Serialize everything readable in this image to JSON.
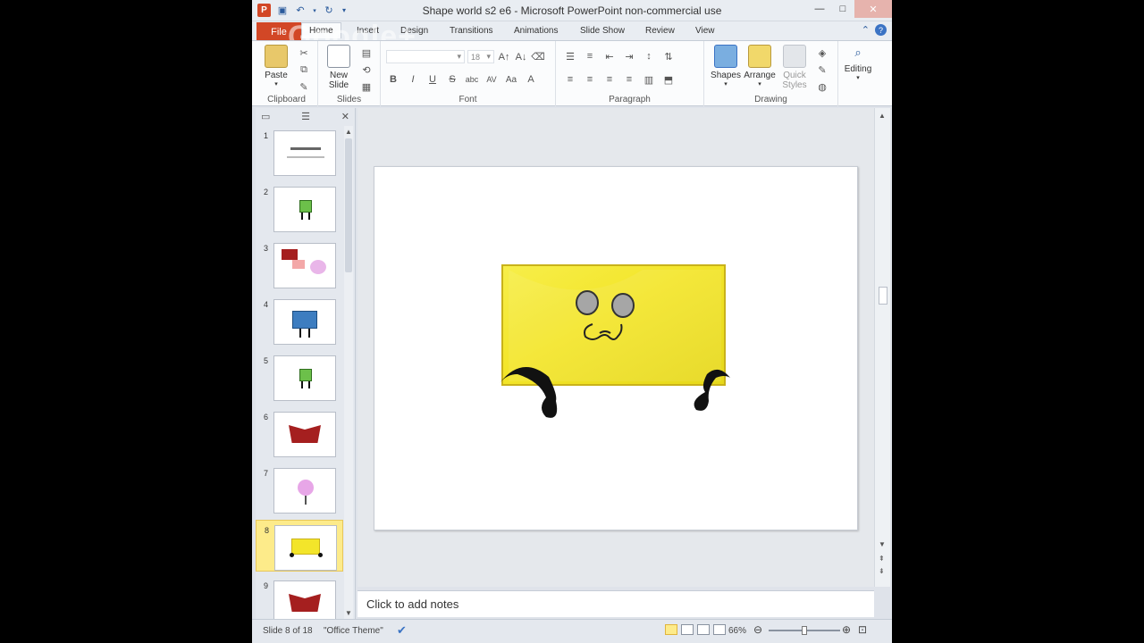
{
  "window": {
    "title": "Shape world s2 e6 - Microsoft PowerPoint non-commercial use",
    "app_letter": "P",
    "minimize": "—",
    "maximize": "□",
    "close": "✕"
  },
  "watermark": "Google+",
  "ribbon": {
    "file_tab": "File",
    "tabs": [
      "Home",
      "Insert",
      "Design",
      "Transitions",
      "Animations",
      "Slide Show",
      "Review",
      "View"
    ],
    "clipboard": {
      "paste": "Paste",
      "label": "Clipboard"
    },
    "slides": {
      "new_slide": "New\nSlide",
      "label": "Slides"
    },
    "font": {
      "font_size": "18",
      "label": "Font",
      "bold": "B",
      "italic": "I",
      "underline": "U",
      "strike": "S",
      "shadow": "abc",
      "spacing": "AV",
      "case": "Aa",
      "color": "A"
    },
    "paragraph": {
      "label": "Paragraph"
    },
    "drawing": {
      "shapes": "Shapes",
      "arrange": "Arrange",
      "quick_styles": "Quick\nStyles",
      "label": "Drawing"
    },
    "editing": {
      "label": "Editing"
    }
  },
  "slide_pane": {
    "thumbnails": [
      {
        "num": "1",
        "kind": "title"
      },
      {
        "num": "2",
        "kind": "green"
      },
      {
        "num": "3",
        "kind": "group"
      },
      {
        "num": "4",
        "kind": "blue"
      },
      {
        "num": "5",
        "kind": "green"
      },
      {
        "num": "6",
        "kind": "red"
      },
      {
        "num": "7",
        "kind": "pink"
      },
      {
        "num": "8",
        "kind": "yellow",
        "selected": true
      },
      {
        "num": "9",
        "kind": "red"
      }
    ]
  },
  "notes": {
    "placeholder": "Click to add notes"
  },
  "status": {
    "slide_info": "Slide 8 of 18",
    "theme": "\"Office Theme\"",
    "zoom": "66%",
    "zoom_level_fraction": 0.5
  },
  "colors": {
    "file_tab": "#d24726",
    "selected_thumb": "#fdeb8a",
    "character_yellow": "#f3e52a"
  }
}
